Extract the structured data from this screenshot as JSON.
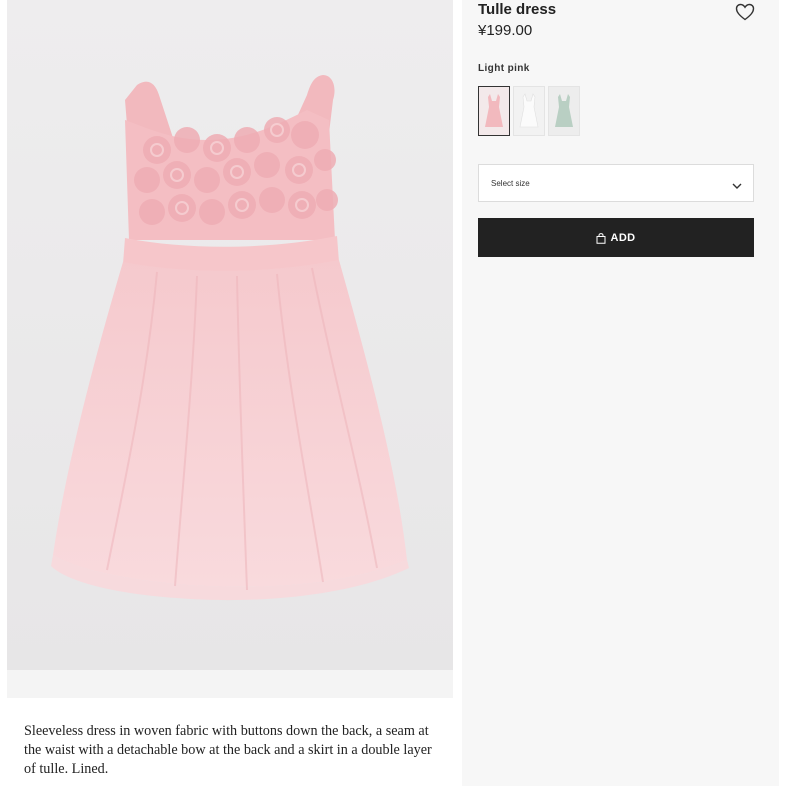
{
  "product": {
    "title": "Tulle dress",
    "price": "¥199.00",
    "description": "Sleeveless dress in woven fabric with buttons down the back, a seam at the waist with a detachable bow at the back and a skirt in a double layer of tulle. Lined."
  },
  "color": {
    "selected_label": "Light pink",
    "swatches": [
      "light-pink",
      "white",
      "sage-green"
    ]
  },
  "size_select": {
    "placeholder": "Select size"
  },
  "add_button": {
    "label": "ADD"
  },
  "icons": {
    "favorite": "heart-icon",
    "size_dropdown": "chevron-down-icon",
    "add_to_bag": "shopping-bag-icon"
  },
  "colors": {
    "button_bg": "#222222",
    "panel_bg": "#f7f7f7",
    "image_bg": "#ebeaeb",
    "dress_pink": "#f6c8cc"
  }
}
